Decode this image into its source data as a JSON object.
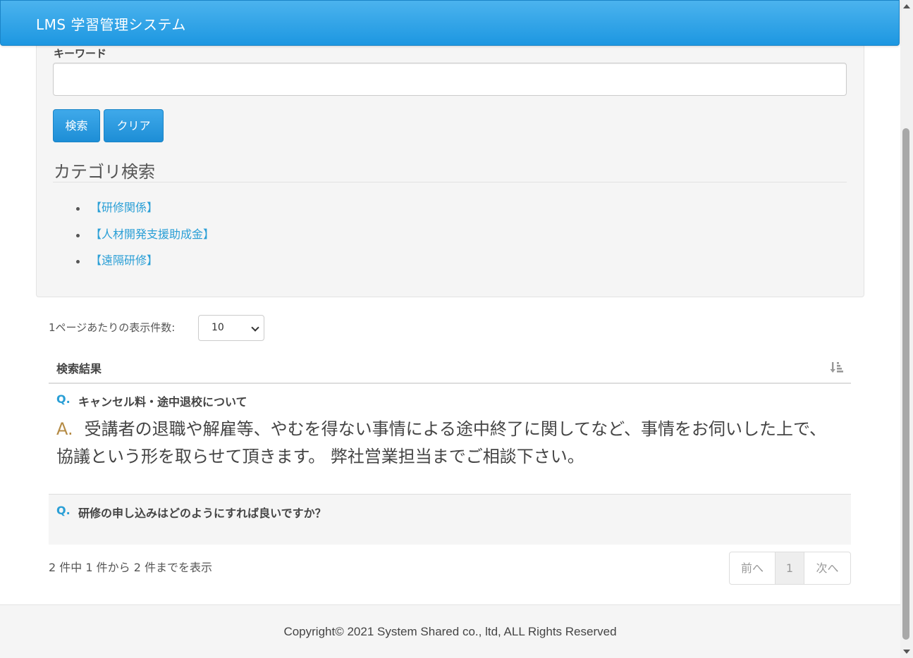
{
  "app": {
    "title": "LMS 学習管理システム"
  },
  "search": {
    "keyword_label": "キーワード",
    "keyword_value": "",
    "search_button": "検索",
    "clear_button": "クリア"
  },
  "categories": {
    "heading": "カテゴリ検索",
    "items": [
      {
        "label": "【研修関係】"
      },
      {
        "label": "【人材開発支援助成金】"
      },
      {
        "label": "【遠隔研修】"
      }
    ]
  },
  "per_page": {
    "label": "1ページあたりの表示件数:",
    "selected": "10"
  },
  "results": {
    "header": "検索結果",
    "items": [
      {
        "q_mark": "Q.",
        "question": "キャンセル料・途中退校について",
        "a_mark": "A.",
        "answer": "受講者の退職や解雇等、やむを得ない事情による途中終了に関してなど、事情をお伺いした上で、協議という形を取らせて頂きます。 弊社営業担当までご相談下さい。"
      },
      {
        "q_mark": "Q.",
        "question": "研修の申し込みはどのようにすれば良いですか？"
      }
    ],
    "info": "2 件中 1 件から 2 件までを表示"
  },
  "pagination": {
    "prev": "前へ",
    "current": "1",
    "next": "次へ"
  },
  "footer": {
    "copyright": "Copyright© 2021 System Shared co., ltd, ALL Rights Reserved"
  },
  "colors": {
    "primary": "#2a9fd6",
    "answer_mark": "#b58b45",
    "navbar": "#1d97e1"
  }
}
